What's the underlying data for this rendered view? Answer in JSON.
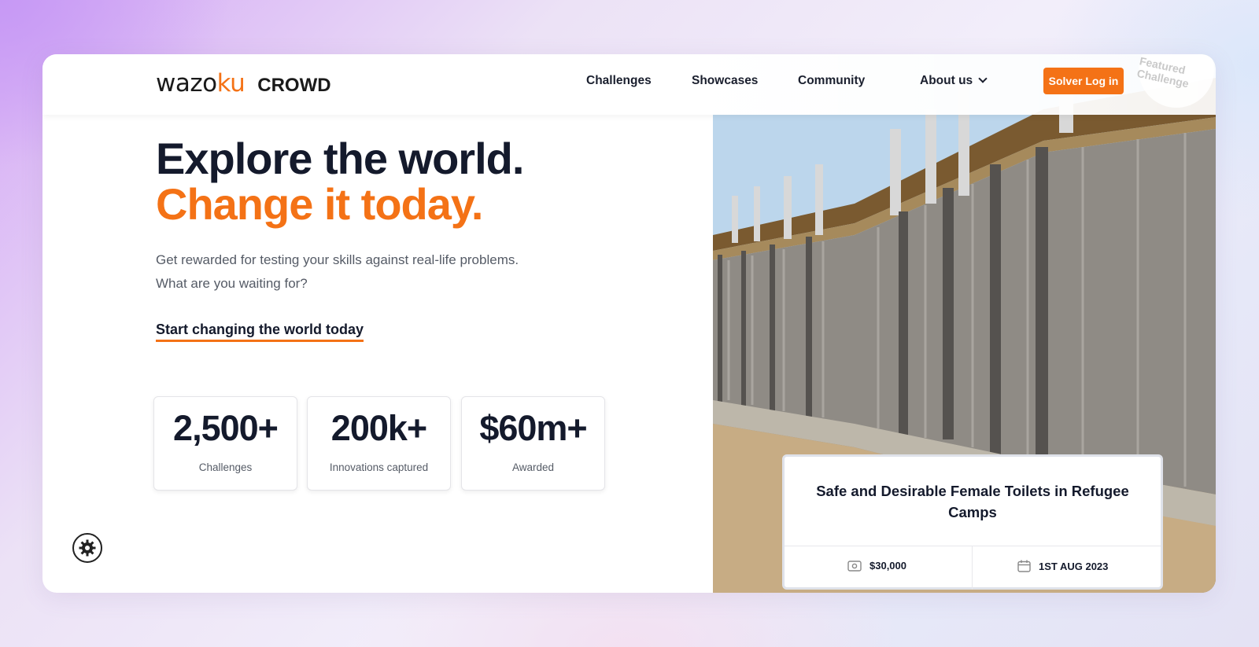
{
  "nav": {
    "logo_part1": "wazo",
    "logo_part2": "ku",
    "logo_part3": "CROWD",
    "links": [
      "Challenges",
      "Showcases",
      "Community",
      "About us"
    ],
    "login_label": "Solver Log in",
    "featured_badge": "Featured Challenge"
  },
  "hero": {
    "title_line1": "Explore the world.",
    "title_line2": "Change it today.",
    "subtitle_line1": "Get rewarded for testing your skills against real-life problems.",
    "subtitle_line2": "What are you waiting for?",
    "cta": "Start changing the world today"
  },
  "stats": [
    {
      "value": "2,500+",
      "label": "Challenges"
    },
    {
      "value": "200k+",
      "label": "Innovations captured"
    },
    {
      "value": "$60m+",
      "label": "Awarded"
    }
  ],
  "challenge": {
    "title": "Safe and Desirable Female Toilets in Refugee Camps",
    "prize": "$30,000",
    "date": "1ST AUG 2023"
  },
  "colors": {
    "accent": "#f47216",
    "text_dark": "#141a2c"
  }
}
